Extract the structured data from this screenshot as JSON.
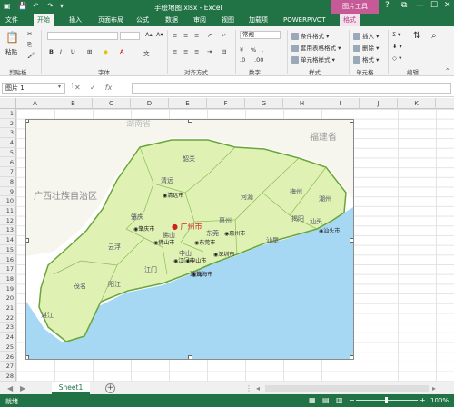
{
  "titlebar": {
    "title": "手绘地图.xlsx - Excel",
    "context_tab_group": "图片工具",
    "help": "?",
    "restore": "⧉",
    "minimize": "—",
    "maximize": "☐",
    "close": "✕"
  },
  "tabs": [
    "文件",
    "开始",
    "插入",
    "页面布局",
    "公式",
    "数据",
    "审阅",
    "视图",
    "加载项",
    "POWERPIVOT",
    "格式"
  ],
  "ribbon": {
    "clipboard": {
      "paste": "粘贴",
      "label": "剪贴板"
    },
    "font": {
      "bold": "B",
      "italic": "I",
      "underline": "U",
      "label": "字体"
    },
    "alignment": {
      "label": "对齐方式"
    },
    "number": {
      "format": "常规",
      "label": "数字"
    },
    "styles": {
      "conditional": "条件格式",
      "table": "套用表格格式",
      "cell": "单元格样式",
      "label": "样式"
    },
    "cells": {
      "insert": "插入",
      "delete": "删除",
      "format": "格式",
      "label": "单元格"
    },
    "editing": {
      "label": "编辑"
    }
  },
  "formula_bar": {
    "name_box": "图片 1",
    "cancel": "✕",
    "enter": "✓",
    "fx": "fx",
    "value": ""
  },
  "grid": {
    "columns": [
      "A",
      "B",
      "C",
      "D",
      "E",
      "F",
      "G",
      "H",
      "I",
      "J",
      "K"
    ],
    "rows": [
      "1",
      "2",
      "3",
      "4",
      "5",
      "6",
      "7",
      "8",
      "9",
      "10",
      "11",
      "12",
      "13",
      "14",
      "15",
      "16",
      "17",
      "18",
      "19",
      "20",
      "21",
      "22",
      "23",
      "24",
      "25",
      "26",
      "27",
      "28"
    ]
  },
  "map": {
    "neighbors": {
      "north": "湖南省",
      "east": "福建省",
      "west": "广西壮族自治区"
    },
    "regions": [
      "韶关",
      "清远",
      "河源",
      "梅州",
      "潮州",
      "肇庆",
      "惠州",
      "揭阳",
      "汕头",
      "云浮",
      "佛山",
      "东莞",
      "汕尾",
      "中山",
      "江门",
      "阳江",
      "茂名",
      "湛江",
      "珠海"
    ],
    "cities": [
      {
        "name": "广州市",
        "capital": true
      },
      {
        "name": "清远市",
        "capital": false
      },
      {
        "name": "肇庆市",
        "capital": false
      },
      {
        "name": "佛山市",
        "capital": false
      },
      {
        "name": "东莞市",
        "capital": false
      },
      {
        "name": "惠州市",
        "capital": false
      },
      {
        "name": "江门市",
        "capital": false
      },
      {
        "name": "中山市",
        "capital": false
      },
      {
        "name": "深圳市",
        "capital": false
      },
      {
        "name": "珠海市",
        "capital": false
      },
      {
        "name": "汕头市",
        "capital": false
      }
    ],
    "colors": {
      "land": "#dff2b3",
      "border": "#6aa43a",
      "sea": "#a6d8f4",
      "capital": "#d02020"
    }
  },
  "sheets": {
    "active": "Sheet1"
  },
  "status": {
    "ready": "就绪",
    "zoom": "100%"
  },
  "colors": {
    "accent": "#217346",
    "format_tab": "#c55a97"
  }
}
